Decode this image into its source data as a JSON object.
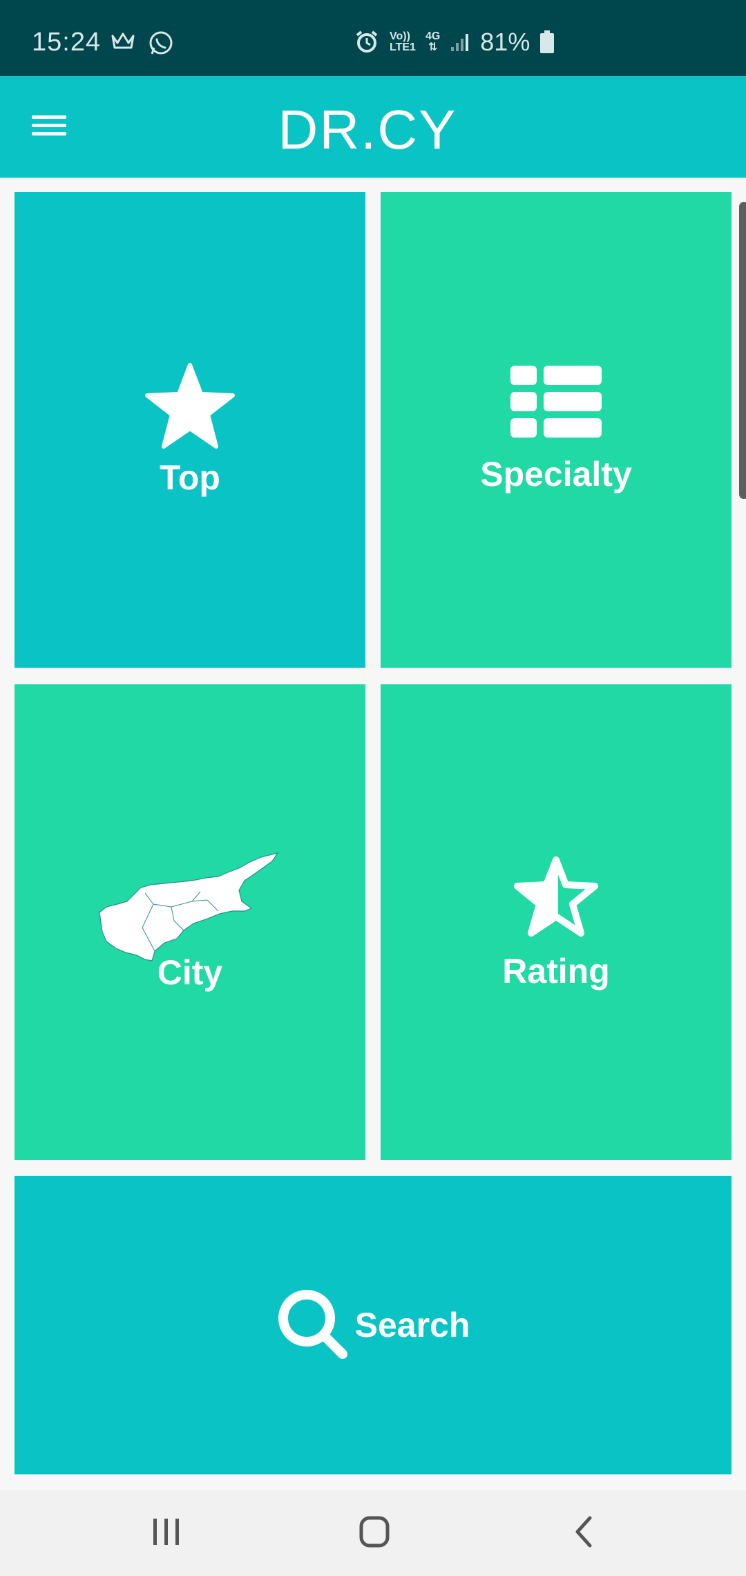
{
  "status_bar": {
    "time": "15:24",
    "network_labels": [
      "Vo))",
      "LTE1",
      "4G"
    ],
    "battery": "81%",
    "icons": [
      "crown-icon",
      "whatsapp-icon",
      "alarm-icon",
      "volte-icon",
      "4g-data-icon",
      "signal-icon",
      "battery-icon"
    ]
  },
  "app_bar": {
    "title": "DR.CY",
    "menu_icon": "hamburger-menu-icon"
  },
  "tiles": {
    "top": {
      "label": "Top",
      "icon": "star-icon"
    },
    "specialty": {
      "label": "Specialty",
      "icon": "list-icon"
    },
    "city": {
      "label": "City",
      "icon": "cyprus-map-icon"
    },
    "rating": {
      "label": "Rating",
      "icon": "half-star-icon"
    },
    "search": {
      "label": "Search",
      "icon": "search-icon"
    }
  },
  "colors": {
    "status_bar": "#00464d",
    "app_bar": "#09c3c5",
    "teal_tile": "#09c3c5",
    "green_tile": "#20d9a4",
    "background": "#f7f7f7"
  },
  "nav_bar": {
    "icons": [
      "recent-apps-icon",
      "home-icon",
      "back-icon"
    ]
  }
}
